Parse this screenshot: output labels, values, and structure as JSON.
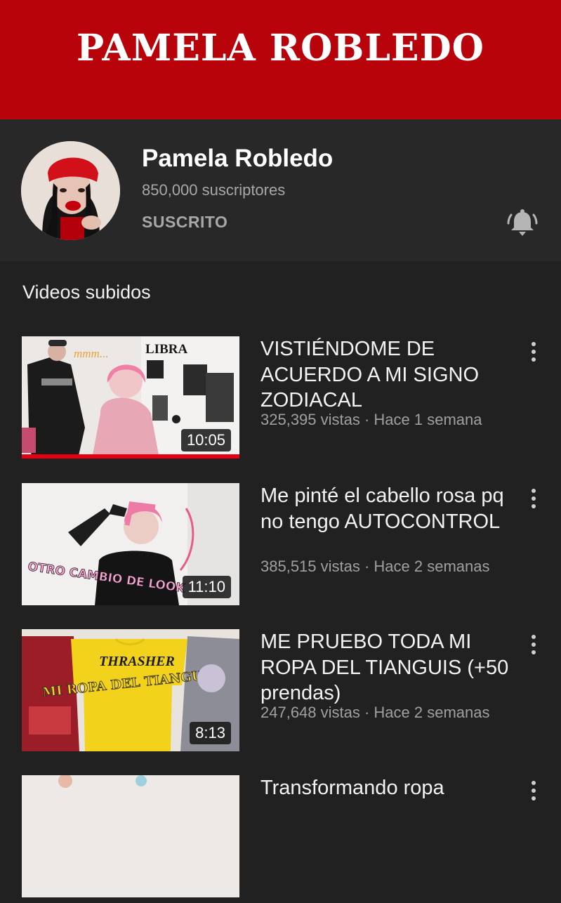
{
  "banner": {
    "title": "PAMELA ROBLEDO",
    "color": "#b8030b"
  },
  "channel": {
    "name": "Pamela Robledo",
    "subscribers": "850,000 suscriptores",
    "subscribe_state": "SUSCRITO",
    "bell_icon": "bell-ringing-icon"
  },
  "section": {
    "title": "Videos subidos"
  },
  "videos": [
    {
      "title": "VISTIÉNDOME DE ACUERDO A MI SIGNO ZODIACAL",
      "meta": "325,395 vistas · Hace 1 semana",
      "duration": "10:05",
      "watched": 1.0,
      "thumb_text": [
        "mmm...",
        "LIBRA"
      ]
    },
    {
      "title": "Me pinté el cabello rosa pq no tengo AUTOCONTROL",
      "meta": "385,515 vistas · Hace 2 semanas",
      "duration": "11:10",
      "thumb_text": [
        "OTRO CAMBIO DE LOOK"
      ]
    },
    {
      "title": "ME PRUEBO TODA MI ROPA DEL TIANGUIS (+50 prendas)",
      "meta": "247,648 vistas · Hace 2 semanas",
      "duration": "8:13",
      "thumb_text": [
        "THRASHER",
        "MI ROPA DEL TIANGUIS"
      ]
    },
    {
      "title": "Transformando ropa"
    }
  ]
}
